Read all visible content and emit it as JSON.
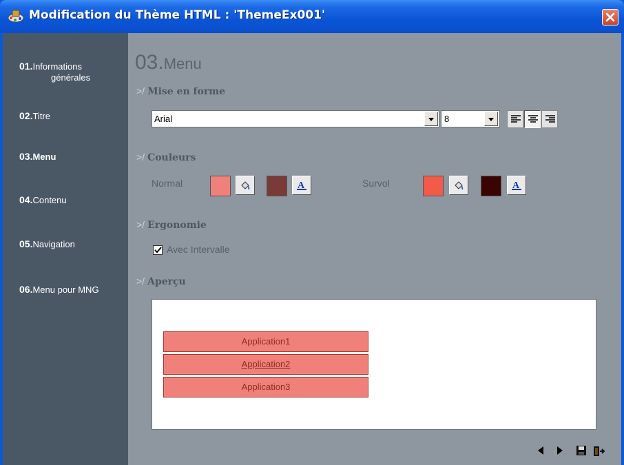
{
  "window": {
    "title": "Modification du Thème HTML : 'ThemeEx001'"
  },
  "sidebar": {
    "items": [
      {
        "num": "01.",
        "label": "Informations",
        "sub": "générales"
      },
      {
        "num": "02.",
        "label": "Titre"
      },
      {
        "num": "03.",
        "label": "Menu"
      },
      {
        "num": "04.",
        "label": "Contenu"
      },
      {
        "num": "05.",
        "label": "Navigation"
      },
      {
        "num": "06.",
        "label": "Menu pour MNG"
      }
    ],
    "active_index": 2
  },
  "page": {
    "number": "03.",
    "title": "Menu"
  },
  "sections": {
    "prefix": ">/",
    "format": "Mise en forme",
    "colors": "Couleurs",
    "ergonomy": "Ergonomie",
    "preview": "Aperçu"
  },
  "format": {
    "font": "Arial",
    "size": "8",
    "alignment_selected": "center"
  },
  "colors": {
    "normal_label": "Normal",
    "hover_label": "Survol",
    "normal_background": "#f0807a",
    "normal_text": "#7a3a38",
    "hover_background": "#f25a4a",
    "hover_text": "#3a0404"
  },
  "ergonomy": {
    "checkbox_label": "Avec Intervalle",
    "checked": true
  },
  "preview": {
    "menu_items": [
      "Application1",
      "Application2",
      "Application3"
    ],
    "hovered_index": 1
  },
  "footer": {
    "icons": [
      "prev-icon",
      "next-icon",
      "save-icon",
      "exit-icon"
    ]
  }
}
